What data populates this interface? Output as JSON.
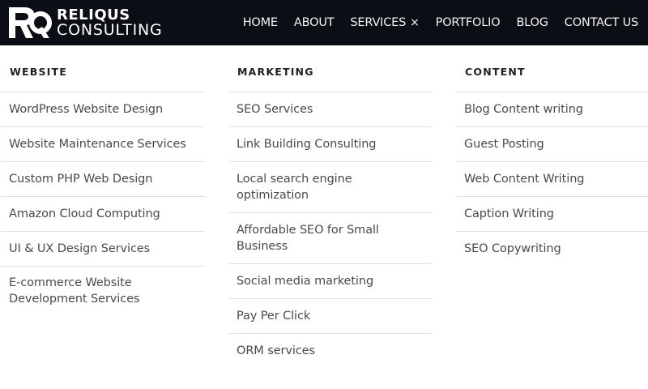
{
  "logo": {
    "line1": "RELIQUS",
    "line2": "CONSULTING"
  },
  "nav": {
    "items": [
      "HOME",
      "ABOUT",
      "SERVICES",
      "PORTFOLIO",
      "BLOG",
      "CONTACT US"
    ],
    "active_close": "×"
  },
  "mega_menu": {
    "columns": [
      {
        "title": "WEBSITE",
        "items": [
          "WordPress Website Design",
          "Website Maintenance Services",
          "Custom PHP Web Design",
          "Amazon Cloud Computing",
          "UI & UX Design Services",
          "E-commerce Website Development Services"
        ]
      },
      {
        "title": "MARKETING",
        "items": [
          "SEO Services",
          "Link Building Consulting",
          "Local search engine optimization",
          "Affordable SEO for Small Business",
          "Social media marketing",
          "Pay Per Click",
          "ORM services"
        ]
      },
      {
        "title": "CONTENT",
        "items": [
          "Blog Content writing",
          "Guest Posting",
          "Web Content Writing",
          "Caption Writing",
          "SEO Copywriting"
        ]
      }
    ]
  },
  "colors": {
    "topbar": "#0b0e14",
    "divider": "#e2e2e2",
    "text": "#4a4a4a",
    "heading": "#222222"
  }
}
